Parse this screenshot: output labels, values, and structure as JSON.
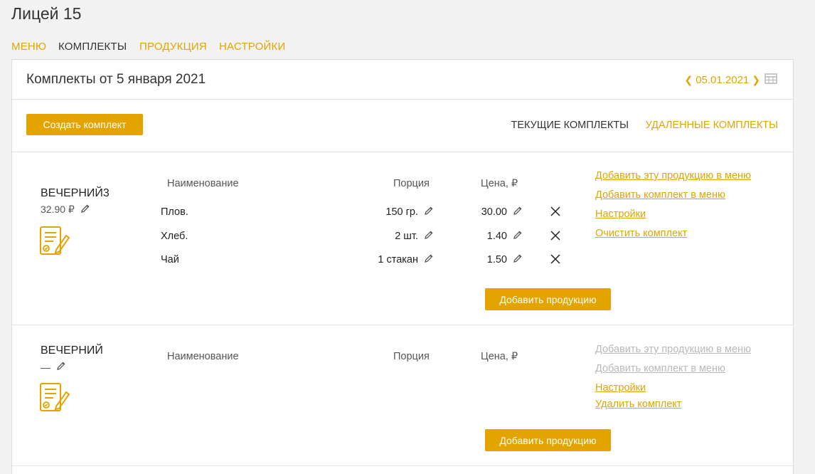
{
  "app": {
    "title": "Лицей 15"
  },
  "nav": {
    "menu": "МЕНЮ",
    "kits": "КОМПЛЕКТЫ",
    "products": "ПРОДУКЦИЯ",
    "settings": "НАСТРОЙКИ"
  },
  "header": {
    "title": "Комплекты от 5 января 2021",
    "date": "05.01.2021",
    "prev_icon": "chevron-left-icon",
    "next_icon": "chevron-right-icon",
    "calendar_icon": "calendar-icon"
  },
  "toolbar": {
    "create_label": "Создать комплект",
    "tab_current": "ТЕКУЩИЕ КОМПЛЕКТЫ",
    "tab_deleted": "УДАЛЕННЫЕ КОМПЛЕКТЫ"
  },
  "columns": {
    "name": "Наименование",
    "portion": "Порция",
    "price": "Цена, ₽"
  },
  "kits": [
    {
      "name": "ВЕЧЕРНИЙ3",
      "price": "32.90 ₽",
      "items": [
        {
          "name": "Плов.",
          "portion": "150 гр.",
          "price": "30.00"
        },
        {
          "name": "Хлеб.",
          "portion": "2 шт.",
          "price": "1.40"
        },
        {
          "name": "Чай",
          "portion": "1 стакан",
          "price": "1.50"
        }
      ],
      "links": [
        "Добавить эту продукцию в меню",
        "Добавить комплект в меню",
        "Настройки",
        "Очистить комплект"
      ],
      "add_label": "Добавить продукцию"
    },
    {
      "name": "ВЕЧЕРНИЙ",
      "price": "—",
      "items": [],
      "links": [
        "Добавить эту продукцию в меню",
        "Добавить комплект в меню",
        "Настройки",
        "Удалить комплект"
      ],
      "add_label": "Добавить продукцию"
    }
  ],
  "colors": {
    "accent": "#e3a400",
    "disabled": "#b9b9b9"
  }
}
